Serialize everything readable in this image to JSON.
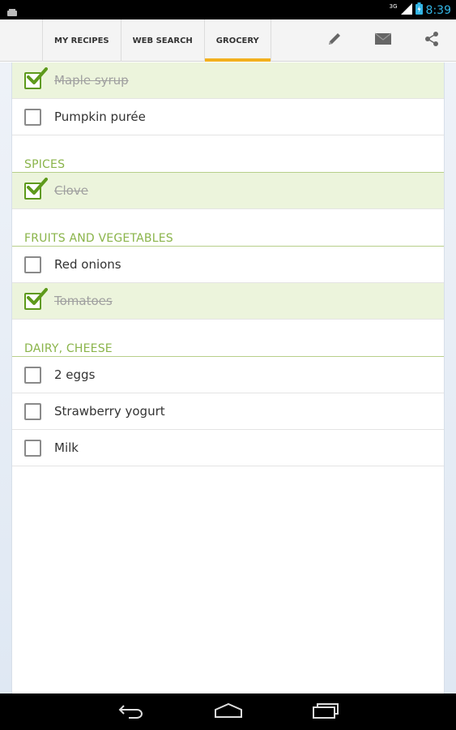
{
  "status_bar": {
    "time": "8:39",
    "network_type": "3G"
  },
  "tabs": [
    {
      "label": "MY RECIPES",
      "selected": false
    },
    {
      "label": "WEB SEARCH",
      "selected": false
    },
    {
      "label": "GROCERY",
      "selected": true
    }
  ],
  "actions": [
    "pencil-icon",
    "mail-icon",
    "share-icon"
  ],
  "grocery": {
    "top_items": [
      {
        "label": "Maple syrup",
        "checked": true
      },
      {
        "label": "Pumpkin purée",
        "checked": false
      }
    ],
    "sections": [
      {
        "title": "SPICES",
        "items": [
          {
            "label": "Clove",
            "checked": true
          }
        ]
      },
      {
        "title": "FRUITS AND VEGETABLES",
        "items": [
          {
            "label": "Red onions",
            "checked": false
          },
          {
            "label": "Tomatoes",
            "checked": true
          }
        ]
      },
      {
        "title": "DAIRY, CHEESE",
        "items": [
          {
            "label": "2 eggs",
            "checked": false
          },
          {
            "label": "Strawberry yogurt",
            "checked": false
          },
          {
            "label": "Milk",
            "checked": false
          }
        ]
      }
    ]
  },
  "colors": {
    "accent_tab": "#f2b01e",
    "check_green": "#5e9a1c",
    "section_green": "#8ab44a",
    "checked_row_bg": "#ecf4dc",
    "clock_blue": "#33b5e5"
  }
}
